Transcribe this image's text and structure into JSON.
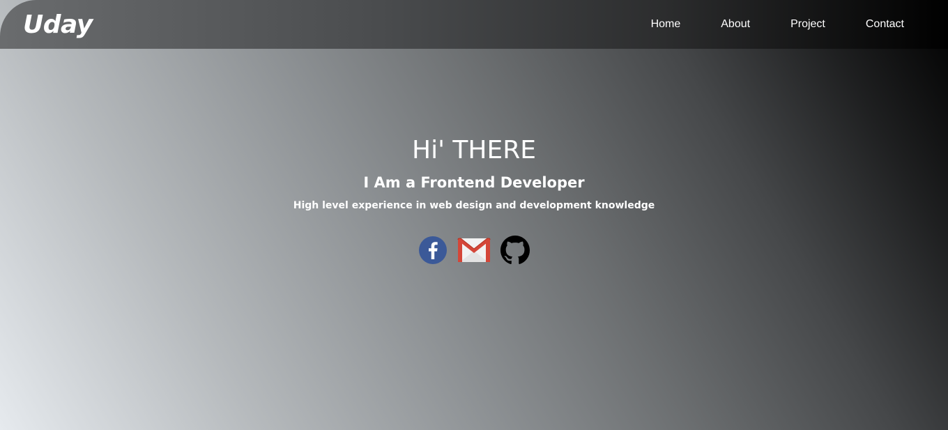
{
  "header": {
    "logo": "Uday",
    "nav": [
      {
        "label": "Home"
      },
      {
        "label": "About"
      },
      {
        "label": "Project"
      },
      {
        "label": "Contact"
      }
    ]
  },
  "hero": {
    "title": "Hi' THERE",
    "subtitle": "I Am a Frontend Developer",
    "description": "High level experience in web design and development knowledge"
  },
  "socials": [
    {
      "icon": "facebook-icon",
      "color": "#3b5998"
    },
    {
      "icon": "gmail-icon",
      "color": "#d44638"
    },
    {
      "icon": "github-icon",
      "color": "#000000"
    }
  ]
}
